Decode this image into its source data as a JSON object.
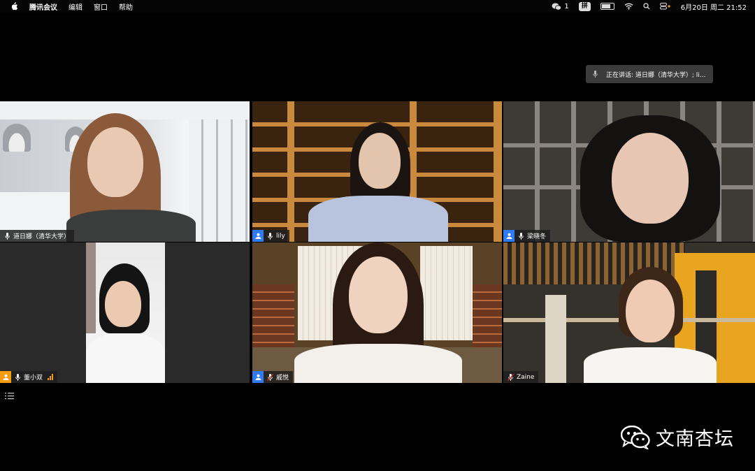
{
  "menubar": {
    "app_name": "腾讯会议",
    "menus": [
      "编辑",
      "窗口",
      "帮助"
    ],
    "wechat_count": "1",
    "ime_label": "拼",
    "datetime": "6月20日 周二  21:52"
  },
  "toast": {
    "text": "正在讲话: 道日娜（清华大学）; li..."
  },
  "participants": [
    {
      "name": "道日娜（清华大学）",
      "avatar": false,
      "mic": "on",
      "active": true
    },
    {
      "name": "lily",
      "avatar": true,
      "mic": "on",
      "active": false
    },
    {
      "name": "梁晓冬",
      "avatar": true,
      "mic": "on",
      "active": false
    },
    {
      "name": "董小双",
      "avatar": true,
      "mic": "on",
      "active": false,
      "signal_bars": 3
    },
    {
      "name": "戚悦",
      "avatar": true,
      "mic": "muted",
      "active": false
    },
    {
      "name": "Zaine",
      "avatar": false,
      "mic": "muted",
      "active": false
    }
  ],
  "watermark": {
    "text": "文南杏坛"
  },
  "colors": {
    "active_speaker": "#23d160",
    "avatar_badge_blue": "#2f7bf5",
    "avatar_badge_orange": "#f39c12",
    "muted_red": "#e5322d"
  }
}
